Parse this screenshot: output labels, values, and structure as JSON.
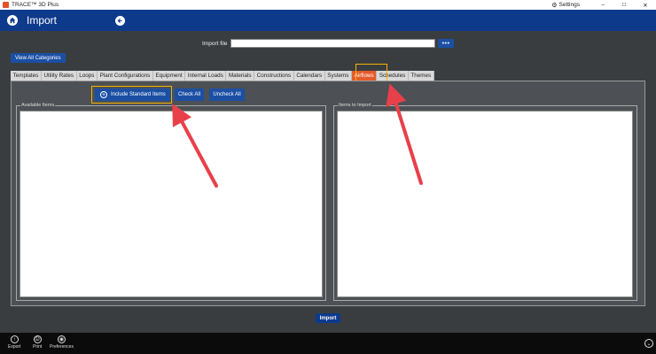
{
  "window": {
    "app_title": "TRACE™ 3D Plus",
    "settings_label": "Settings",
    "minimize": "–",
    "maximize": "□",
    "close": "✕"
  },
  "header": {
    "title": "Import"
  },
  "import_file": {
    "label": "Import file",
    "value": "",
    "browse_label": "•••"
  },
  "view_all_label": "View All Categories",
  "tabs": [
    {
      "label": "Templates"
    },
    {
      "label": "Utility Rates"
    },
    {
      "label": "Loops"
    },
    {
      "label": "Plant Configurations"
    },
    {
      "label": "Equipment"
    },
    {
      "label": "Internal Loads"
    },
    {
      "label": "Materials"
    },
    {
      "label": "Constructions"
    },
    {
      "label": "Calendars"
    },
    {
      "label": "Systems"
    },
    {
      "label": "Airflows",
      "active": true
    },
    {
      "label": "Schedules"
    },
    {
      "label": "Themes"
    }
  ],
  "toolbar": {
    "include_standard": "Include Standard Items",
    "check_all": "Check All",
    "uncheck_all": "Uncheck All"
  },
  "available_items": {
    "label": "Available Items"
  },
  "items_to_import": {
    "label": "Items to Import"
  },
  "import_button": "Import",
  "bottom_bar": {
    "export": "Export",
    "print": "Print",
    "preferences": "Preferences"
  },
  "colors": {
    "header": "#0e3a8c",
    "button": "#1b4fa3",
    "active_tab": "#e55a2b",
    "highlight": "#f5b400",
    "annotation_arrow": "#e8404a"
  }
}
